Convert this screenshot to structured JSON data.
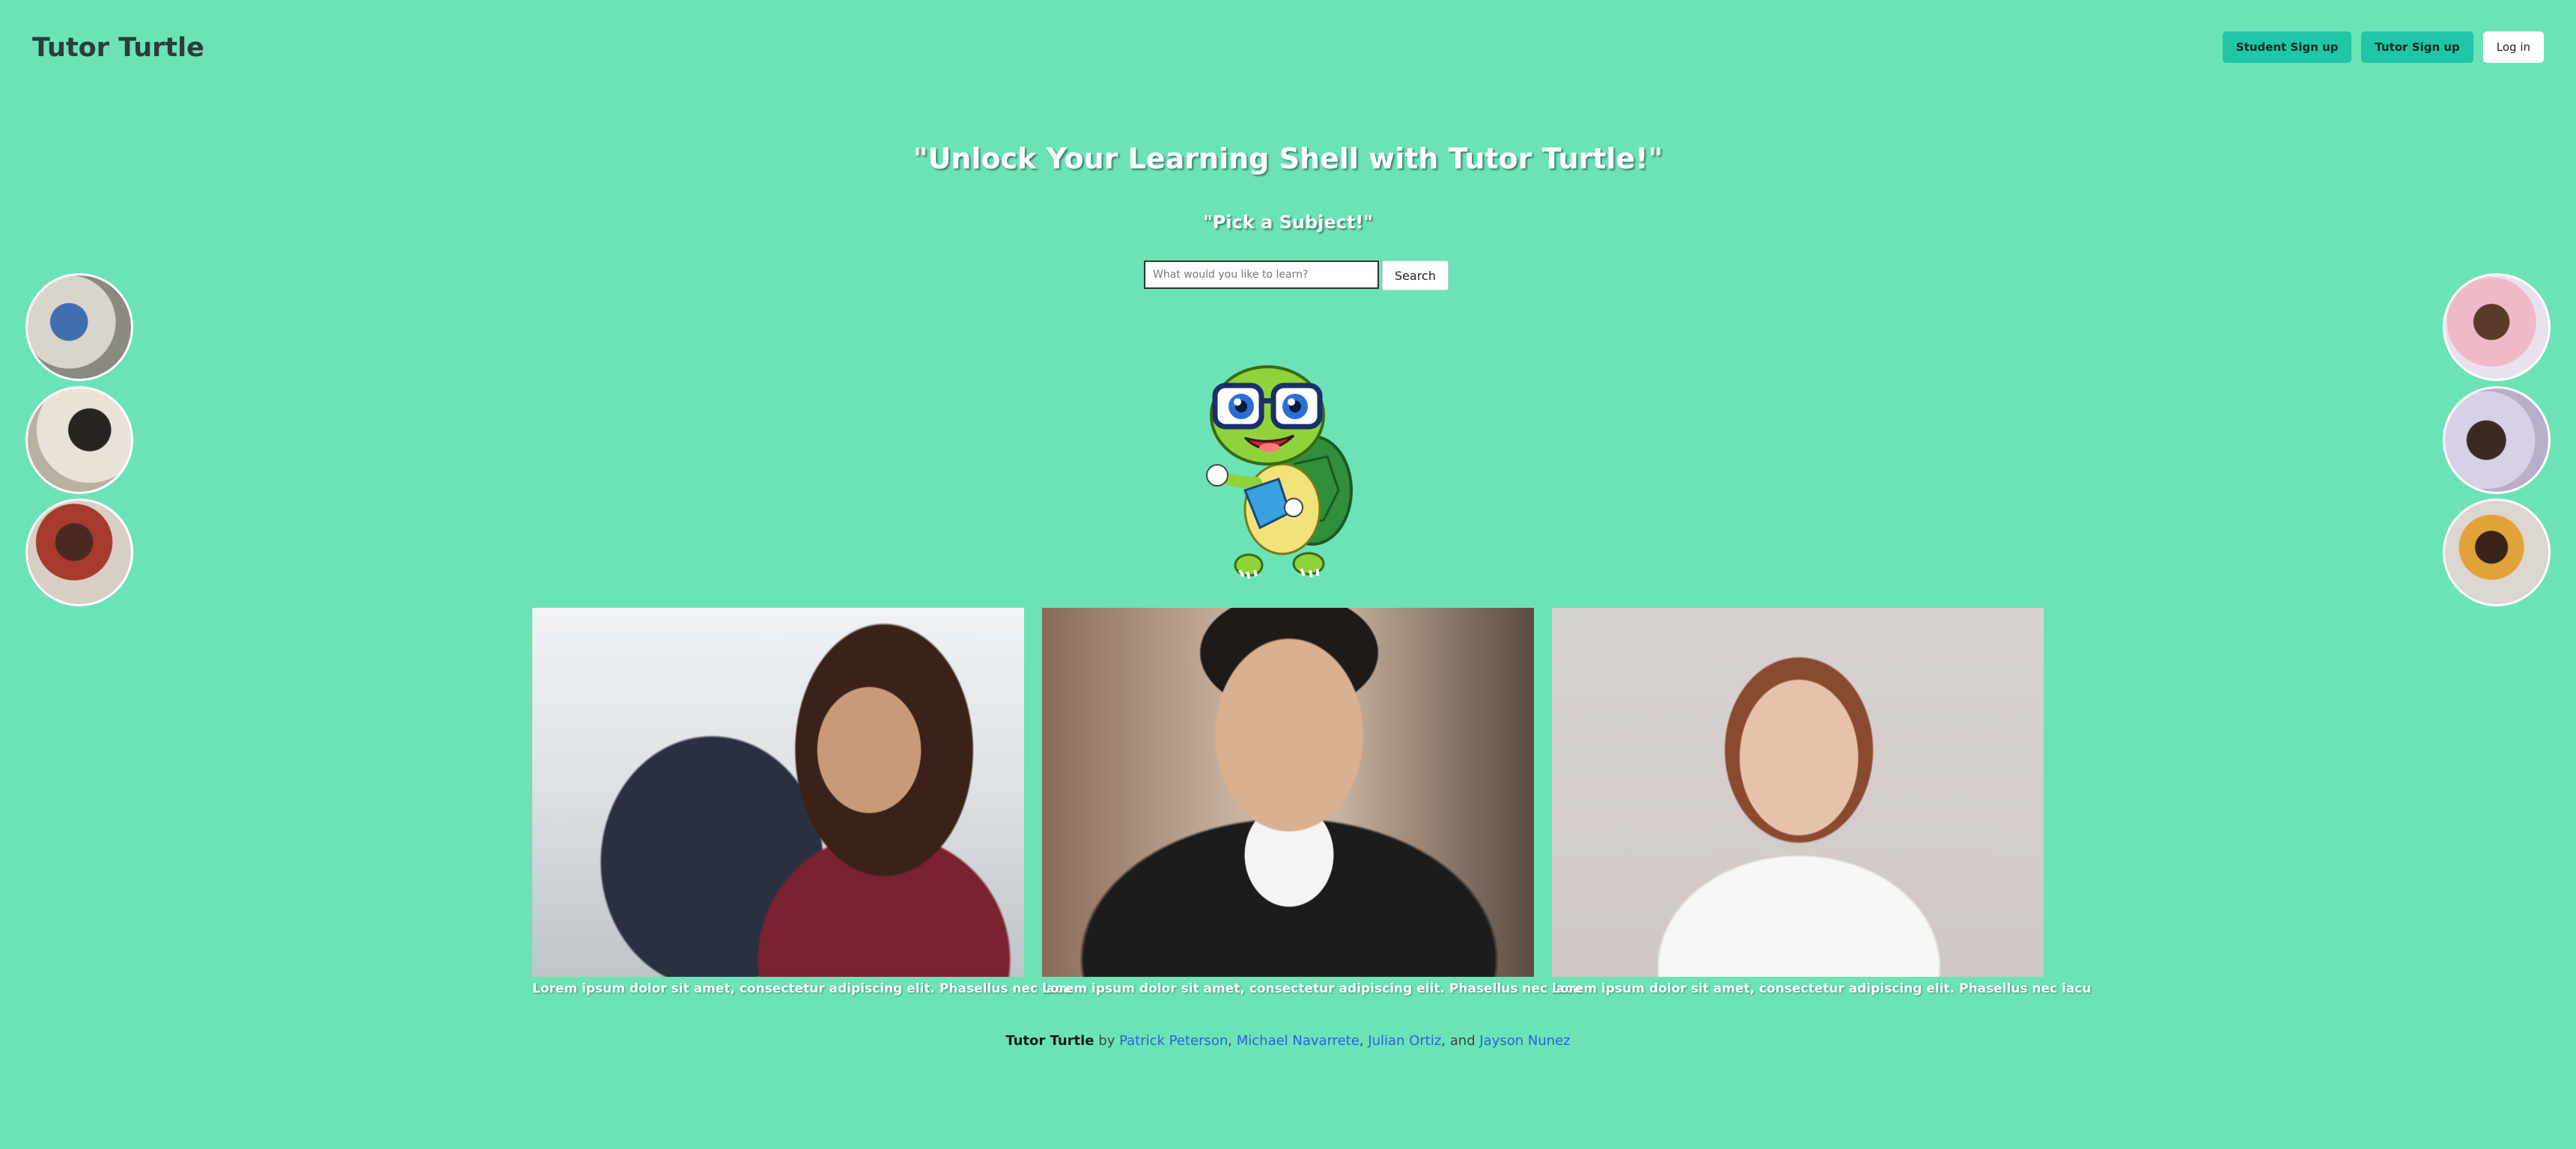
{
  "header": {
    "brand": "Tutor Turtle",
    "student_signup": "Student Sign up",
    "tutor_signup": "Tutor Sign up",
    "login": "Log in"
  },
  "hero": {
    "headline": "\"Unlock Your Learning Shell with Tutor Turtle!\"",
    "subhead": "\"Pick a Subject!\"",
    "search_placeholder": "What would you like to learn?",
    "search_button": "Search"
  },
  "cards": [
    {
      "caption": "Lorem ipsum dolor sit amet, consectetur adipiscing elit. Phasellus nec iacu"
    },
    {
      "caption": "Lorem ipsum dolor sit amet, consectetur adipiscing elit. Phasellus nec iacu"
    },
    {
      "caption": "Lorem ipsum dolor sit amet, consectetur adipiscing elit. Phasellus nec iacu"
    }
  ],
  "footer": {
    "brand": "Tutor Turtle",
    "by": "by",
    "authors": [
      "Patrick Peterson",
      "Michael Navarrete",
      "Julian Ortiz"
    ],
    "and": "and",
    "last_author": "Jayson Nunez"
  },
  "colors": {
    "background": "#6be3b6",
    "accent_button": "#1fc6a8",
    "link": "#2a5fe6"
  }
}
